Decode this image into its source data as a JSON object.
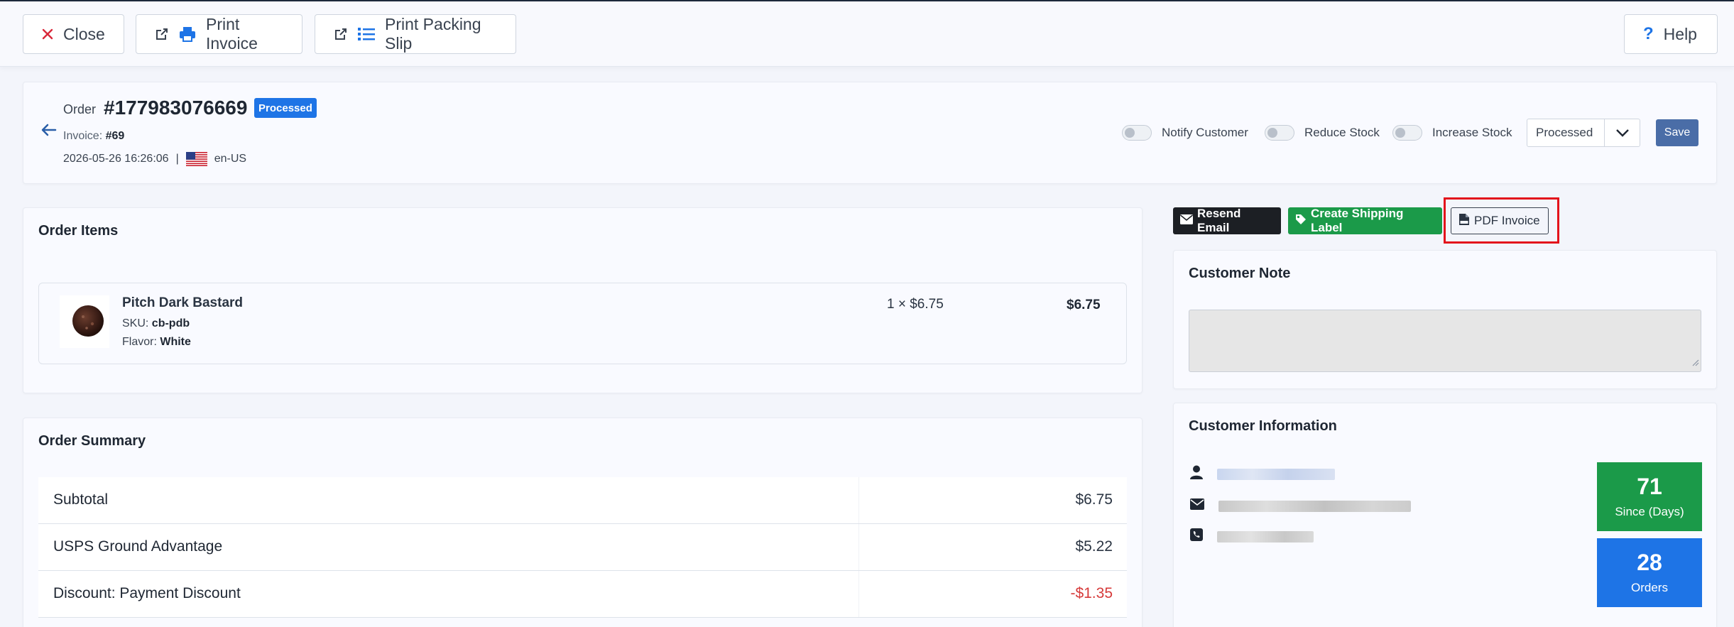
{
  "toolbar": {
    "close_label": "Close",
    "print_invoice_label": "Print Invoice",
    "print_packing_slip_label": "Print Packing Slip",
    "help_label": "Help"
  },
  "order": {
    "label": "Order",
    "number": "#177983076669",
    "status_badge": "Processed",
    "invoice_label": "Invoice:",
    "invoice_number": "#69",
    "datetime": "2026-05-26 16:26:06",
    "separator": "|",
    "locale": "en-US"
  },
  "controls": {
    "notify_customer": "Notify Customer",
    "reduce_stock": "Reduce Stock",
    "increase_stock": "Increase Stock",
    "status_select_value": "Processed",
    "save_label": "Save"
  },
  "order_items": {
    "title": "Order Items",
    "items": [
      {
        "name": "Pitch Dark Bastard",
        "sku_label": "SKU:",
        "sku": "cb-pdb",
        "flavor_label": "Flavor:",
        "flavor": "White",
        "qty_price": "1 × $6.75",
        "total": "$6.75"
      }
    ]
  },
  "order_summary": {
    "title": "Order Summary",
    "rows": [
      {
        "label": "Subtotal",
        "value": "$6.75"
      },
      {
        "label": "USPS Ground Advantage",
        "value": "$5.22"
      },
      {
        "label": "Discount: Payment Discount",
        "value": "-$1.35"
      }
    ]
  },
  "actions": {
    "resend_email": "Resend Email",
    "create_shipping_label": "Create Shipping Label",
    "pdf_invoice": "PDF Invoice"
  },
  "customer_note": {
    "title": "Customer Note"
  },
  "customer_info": {
    "title": "Customer Information",
    "stats": [
      {
        "value": "71",
        "caption": "Since (Days)"
      },
      {
        "value": "28",
        "caption": "Orders"
      }
    ]
  },
  "colors": {
    "primary_blue": "#1e74e6",
    "success_green": "#1b9a49",
    "danger_red": "#d63a3a",
    "save_blue": "#4a6da7",
    "highlight_red": "#e3131b"
  }
}
